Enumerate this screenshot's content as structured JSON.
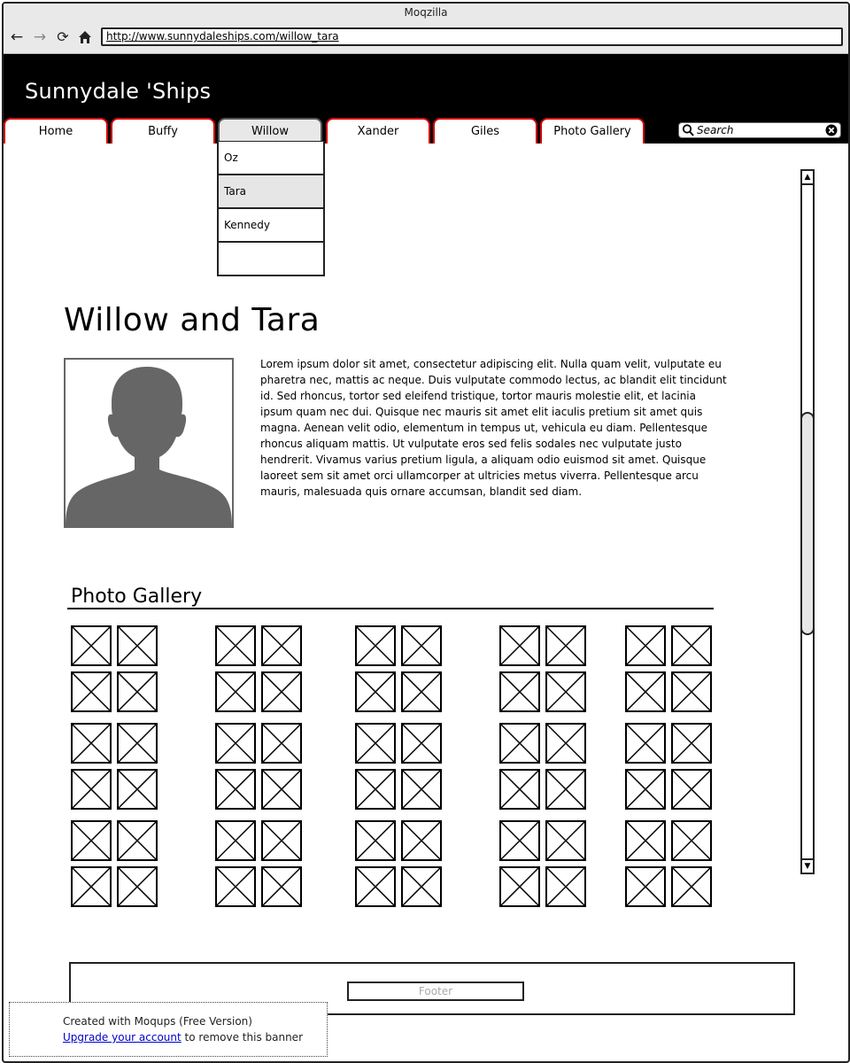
{
  "browser": {
    "window_title": "Moqzilla",
    "url": "http://www.sunnydaleships.com/willow_tara"
  },
  "header": {
    "site_title": "Sunnydale 'Ships",
    "search_placeholder": "Search"
  },
  "nav": {
    "tabs": [
      {
        "label": "Home",
        "active": false
      },
      {
        "label": "Buffy",
        "active": false
      },
      {
        "label": "Willow",
        "active": true
      },
      {
        "label": "Xander",
        "active": false
      },
      {
        "label": "Giles",
        "active": false
      },
      {
        "label": "Photo Gallery",
        "active": false
      }
    ],
    "tab_border_color": "#d10000"
  },
  "dropdown": {
    "items": [
      {
        "label": "Oz",
        "highlighted": false
      },
      {
        "label": "Tara",
        "highlighted": true
      },
      {
        "label": "Kennedy",
        "highlighted": false
      },
      {
        "label": "",
        "highlighted": false
      }
    ]
  },
  "content": {
    "heading": "Willow and Tara",
    "body": "Lorem ipsum dolor sit amet, consectetur adipiscing elit. Nulla quam velit, vulputate eu pharetra nec, mattis ac neque. Duis vulputate commodo lectus, ac blandit elit tincidunt id. Sed rhoncus, tortor sed eleifend tristique, tortor mauris molestie elit, et lacinia ipsum quam nec dui. Quisque nec mauris sit amet elit iaculis pretium sit amet quis magna. Aenean velit odio, elementum in tempus ut, vehicula eu diam. Pellentesque rhoncus aliquam mattis. Ut vulputate eros sed felis sodales nec vulputate justo hendrerit. Vivamus varius pretium ligula, a aliquam odio euismod sit amet. Quisque laoreet sem sit amet orci ullamcorper at ultricies metus viverra. Pellentesque arcu mauris, malesuada quis ornare accumsan, blandit sed diam."
  },
  "gallery": {
    "heading": "Photo Gallery",
    "column_groups": 5,
    "row_blocks": 3,
    "image_placeholder_icon": "image-placeholder-icon"
  },
  "footer": {
    "label": "Footer"
  },
  "banner": {
    "line1": "Created with Moqups (Free Version)",
    "link_text": "Upgrade your account",
    "line2_suffix": " to remove this banner"
  },
  "icons": {
    "back": "back-arrow-icon",
    "forward": "forward-arrow-icon",
    "reload": "reload-icon",
    "home": "home-icon",
    "search": "search-icon",
    "clear": "clear-icon"
  }
}
